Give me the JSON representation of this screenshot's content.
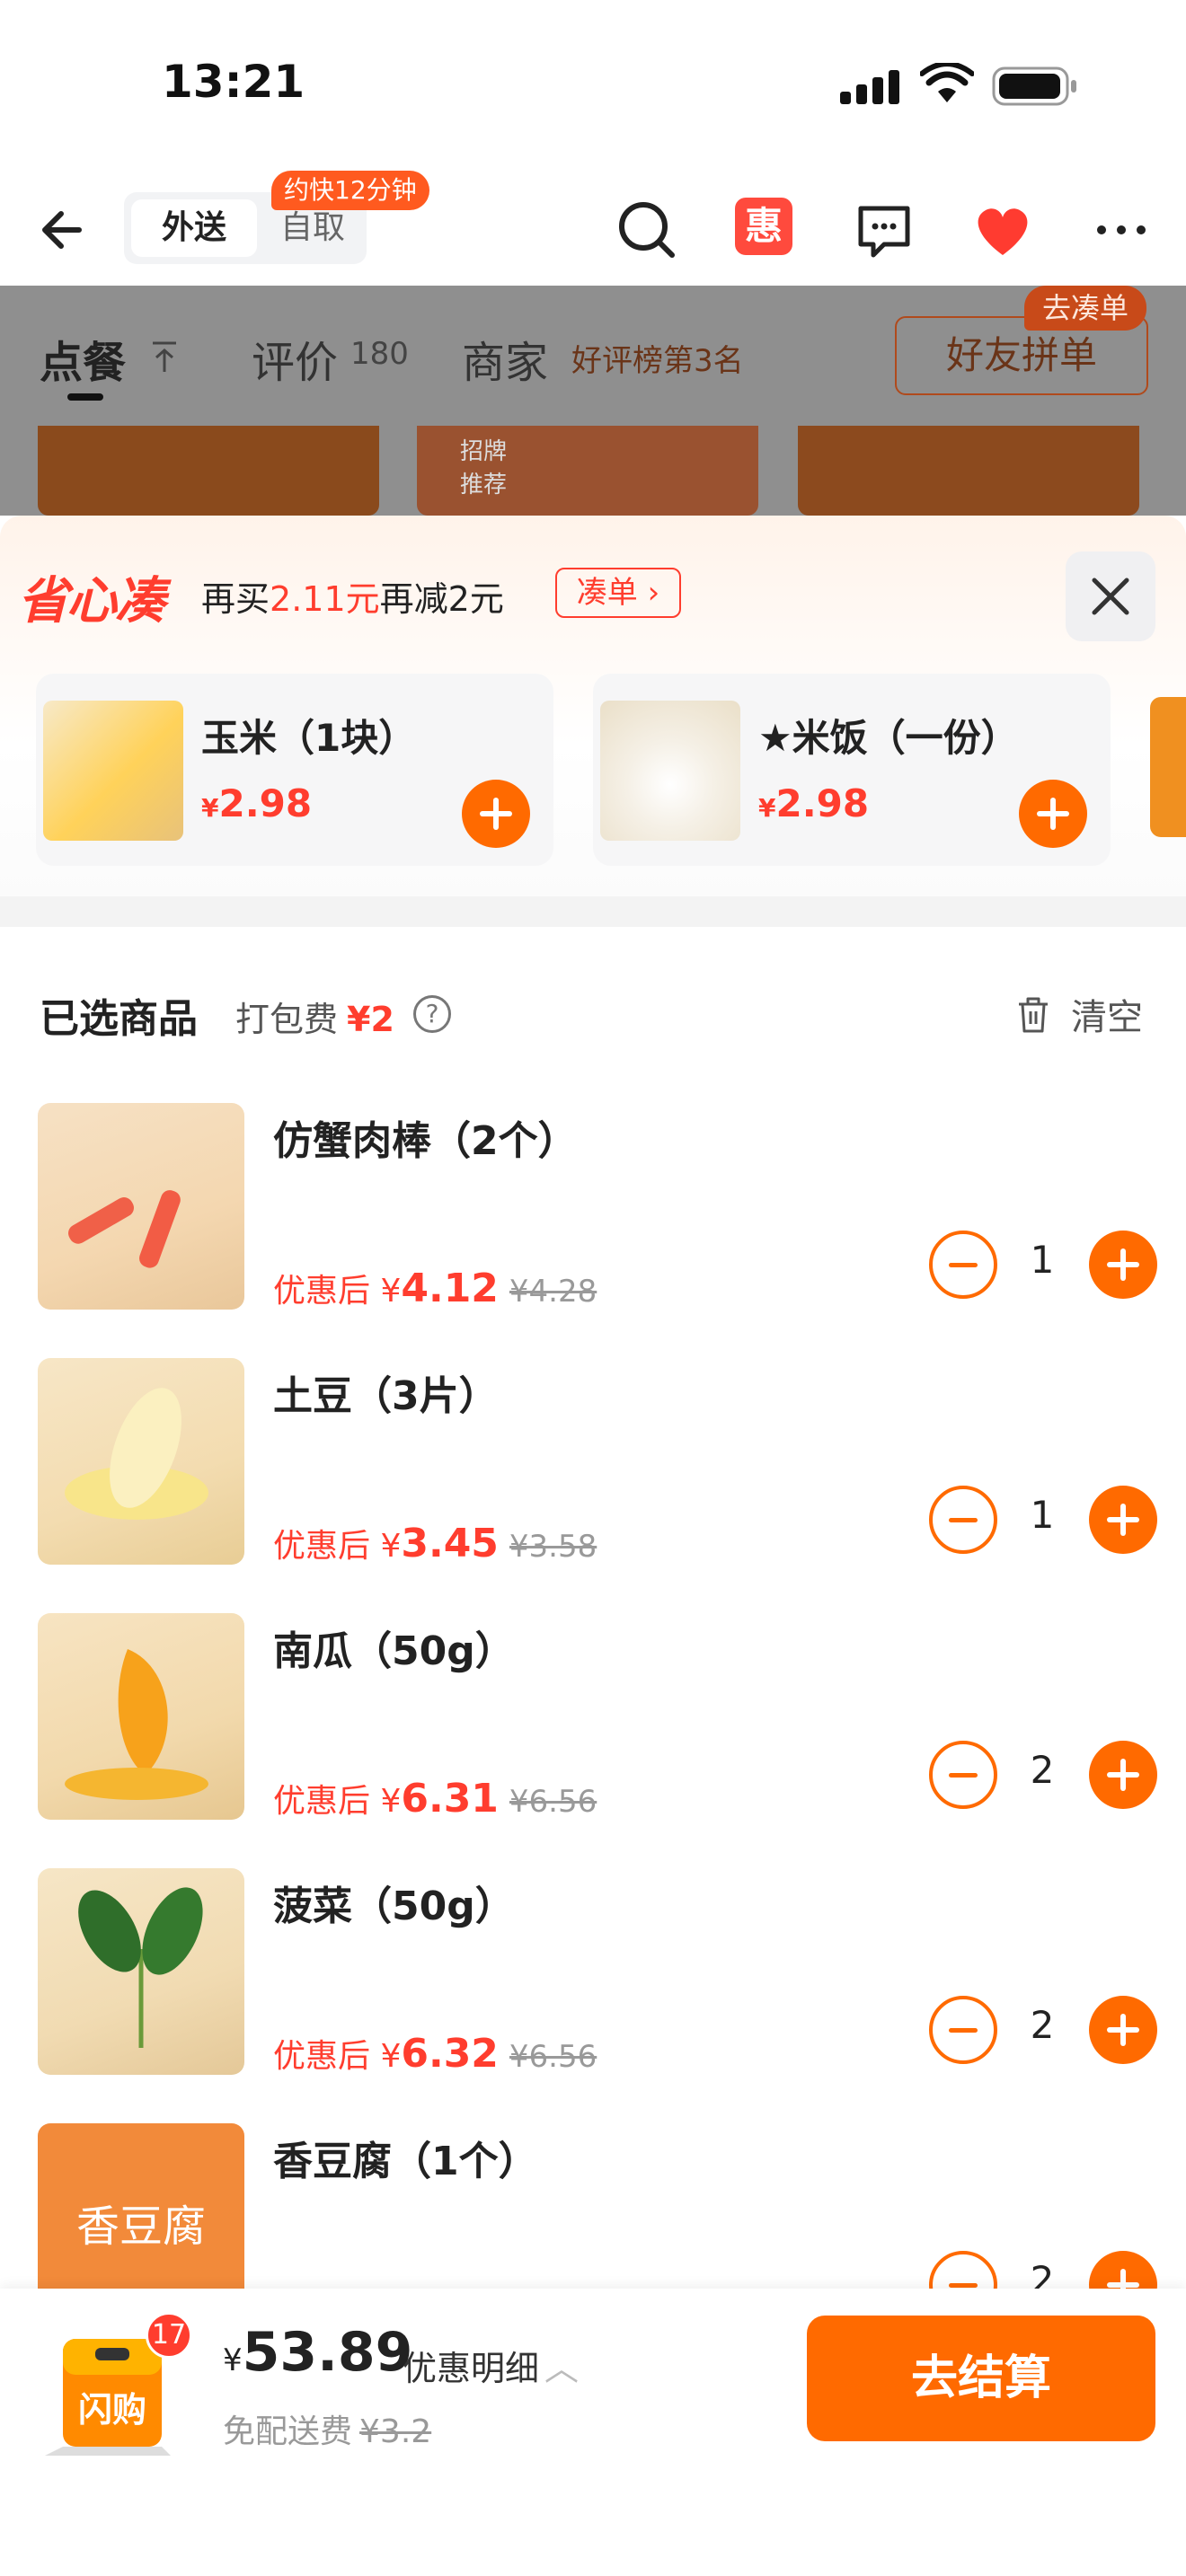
{
  "status_bar": {
    "time": "13:21"
  },
  "nav": {
    "delivery_tab": "外送",
    "pickup_tab": "自取",
    "eta_badge": "约快12分钟",
    "hui_label": "惠"
  },
  "store_tabs": {
    "order": "点餐",
    "reviews": "评价",
    "reviews_count": "180",
    "merchant": "商家",
    "merchant_sub": "好评榜第3名",
    "friend_order": "好友拼单",
    "go_bubble": "去凑单",
    "banner_text": "招牌\n推荐"
  },
  "promo": {
    "brand": "省心凑",
    "text_prefix": "再买",
    "amount": "2.11元",
    "text_suffix": "再减2元",
    "button": "凑单 ›"
  },
  "addons": [
    {
      "name": "玉米（1块）",
      "currency": "¥",
      "price": "2.98"
    },
    {
      "name": "★米饭（一份）",
      "currency": "¥",
      "price": "2.98"
    }
  ],
  "selected": {
    "title": "已选商品",
    "pack_fee_label": "打包费",
    "pack_fee": "¥2",
    "help": "?",
    "clear": "清空"
  },
  "items": [
    {
      "name": "仿蟹肉棒（2个）",
      "after_label": "优惠后 ¥",
      "price": "4.12",
      "original": "¥4.28",
      "qty": "1"
    },
    {
      "name": "土豆（3片）",
      "after_label": "优惠后 ¥",
      "price": "3.45",
      "original": "¥3.58",
      "qty": "1"
    },
    {
      "name": "南瓜（50g）",
      "after_label": "优惠后 ¥",
      "price": "6.31",
      "original": "¥6.56",
      "qty": "2"
    },
    {
      "name": "菠菜（50g）",
      "after_label": "优惠后 ¥",
      "price": "6.32",
      "original": "¥6.56",
      "qty": "2"
    },
    {
      "name": "香豆腐（1个）",
      "thumb_text": "香豆腐",
      "qty": "2"
    }
  ],
  "bottom": {
    "badge": "17",
    "bag_label": "闪购",
    "currency": "¥",
    "total": "53.89",
    "detail": "优惠明细",
    "shipping_label": "免配送费",
    "shipping_original": "¥3.2",
    "checkout": "去结算"
  },
  "colors": {
    "accent": "#ff6a00",
    "price_red": "#ff3d2e",
    "badge_orange": "#ff5a1f"
  }
}
